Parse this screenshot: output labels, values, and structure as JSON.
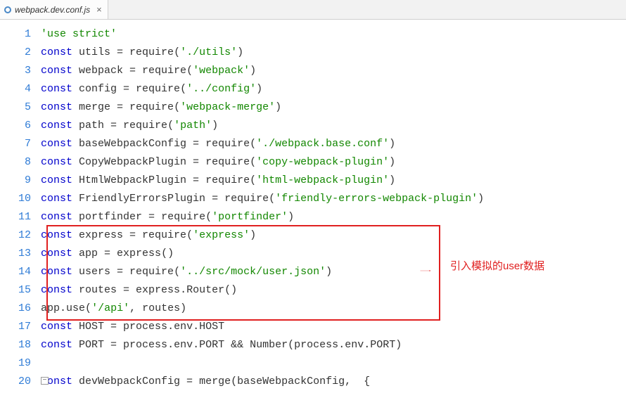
{
  "tab": {
    "filename": "webpack.dev.conf.js",
    "close_glyph": "×"
  },
  "annotation": {
    "text": "引入模拟的user数据"
  },
  "fold_glyph": "−",
  "code": {
    "lines": [
      {
        "n": 1,
        "tokens": [
          [
            "str",
            "'use strict'"
          ]
        ]
      },
      {
        "n": 2,
        "tokens": [
          [
            "kw",
            "const"
          ],
          [
            "id",
            " utils "
          ],
          [
            "op",
            "= "
          ],
          [
            "id",
            "require"
          ],
          [
            "op",
            "("
          ],
          [
            "str",
            "'./utils'"
          ],
          [
            "op",
            ")"
          ]
        ]
      },
      {
        "n": 3,
        "tokens": [
          [
            "kw",
            "const"
          ],
          [
            "id",
            " webpack "
          ],
          [
            "op",
            "= "
          ],
          [
            "id",
            "require"
          ],
          [
            "op",
            "("
          ],
          [
            "str",
            "'webpack'"
          ],
          [
            "op",
            ")"
          ]
        ]
      },
      {
        "n": 4,
        "tokens": [
          [
            "kw",
            "const"
          ],
          [
            "id",
            " config "
          ],
          [
            "op",
            "= "
          ],
          [
            "id",
            "require"
          ],
          [
            "op",
            "("
          ],
          [
            "str",
            "'../config'"
          ],
          [
            "op",
            ")"
          ]
        ]
      },
      {
        "n": 5,
        "tokens": [
          [
            "kw",
            "const"
          ],
          [
            "id",
            " merge "
          ],
          [
            "op",
            "= "
          ],
          [
            "id",
            "require"
          ],
          [
            "op",
            "("
          ],
          [
            "str",
            "'webpack-merge'"
          ],
          [
            "op",
            ")"
          ]
        ]
      },
      {
        "n": 6,
        "tokens": [
          [
            "kw",
            "const"
          ],
          [
            "id",
            " path "
          ],
          [
            "op",
            "= "
          ],
          [
            "id",
            "require"
          ],
          [
            "op",
            "("
          ],
          [
            "str",
            "'path'"
          ],
          [
            "op",
            ")"
          ]
        ]
      },
      {
        "n": 7,
        "tokens": [
          [
            "kw",
            "const"
          ],
          [
            "id",
            " baseWebpackConfig "
          ],
          [
            "op",
            "= "
          ],
          [
            "id",
            "require"
          ],
          [
            "op",
            "("
          ],
          [
            "str",
            "'./webpack.base.conf'"
          ],
          [
            "op",
            ")"
          ]
        ]
      },
      {
        "n": 8,
        "tokens": [
          [
            "kw",
            "const"
          ],
          [
            "id",
            " CopyWebpackPlugin "
          ],
          [
            "op",
            "= "
          ],
          [
            "id",
            "require"
          ],
          [
            "op",
            "("
          ],
          [
            "str",
            "'copy-webpack-plugin'"
          ],
          [
            "op",
            ")"
          ]
        ]
      },
      {
        "n": 9,
        "tokens": [
          [
            "kw",
            "const"
          ],
          [
            "id",
            " HtmlWebpackPlugin "
          ],
          [
            "op",
            "= "
          ],
          [
            "id",
            "require"
          ],
          [
            "op",
            "("
          ],
          [
            "str",
            "'html-webpack-plugin'"
          ],
          [
            "op",
            ")"
          ]
        ]
      },
      {
        "n": 10,
        "tokens": [
          [
            "kw",
            "const"
          ],
          [
            "id",
            " FriendlyErrorsPlugin "
          ],
          [
            "op",
            "= "
          ],
          [
            "id",
            "require"
          ],
          [
            "op",
            "("
          ],
          [
            "str",
            "'friendly-errors-webpack-plugin'"
          ],
          [
            "op",
            ")"
          ]
        ]
      },
      {
        "n": 11,
        "tokens": [
          [
            "kw",
            "const"
          ],
          [
            "id",
            " portfinder "
          ],
          [
            "op",
            "= "
          ],
          [
            "id",
            "require"
          ],
          [
            "op",
            "("
          ],
          [
            "str",
            "'portfinder'"
          ],
          [
            "op",
            ")"
          ]
        ]
      },
      {
        "n": 12,
        "tokens": [
          [
            "kw",
            "const"
          ],
          [
            "id",
            " express "
          ],
          [
            "op",
            "= "
          ],
          [
            "id",
            "require"
          ],
          [
            "op",
            "("
          ],
          [
            "str",
            "'express'"
          ],
          [
            "op",
            ")"
          ]
        ]
      },
      {
        "n": 13,
        "tokens": [
          [
            "kw",
            "const"
          ],
          [
            "id",
            " app "
          ],
          [
            "op",
            "= "
          ],
          [
            "id",
            "express"
          ],
          [
            "op",
            "()"
          ]
        ]
      },
      {
        "n": 14,
        "tokens": [
          [
            "kw",
            "const"
          ],
          [
            "id",
            " users "
          ],
          [
            "op",
            "= "
          ],
          [
            "id",
            "require"
          ],
          [
            "op",
            "("
          ],
          [
            "str",
            "'../src/mock/user.json'"
          ],
          [
            "op",
            ")"
          ]
        ]
      },
      {
        "n": 15,
        "tokens": [
          [
            "kw",
            "const"
          ],
          [
            "id",
            " routes "
          ],
          [
            "op",
            "= "
          ],
          [
            "id",
            "express"
          ],
          [
            "op",
            "."
          ],
          [
            "id",
            "Router"
          ],
          [
            "op",
            "()"
          ]
        ]
      },
      {
        "n": 16,
        "tokens": [
          [
            "id",
            "app"
          ],
          [
            "op",
            "."
          ],
          [
            "id",
            "use"
          ],
          [
            "op",
            "("
          ],
          [
            "str",
            "'/api'"
          ],
          [
            "op",
            ", "
          ],
          [
            "id",
            "routes"
          ],
          [
            "op",
            ")"
          ]
        ]
      },
      {
        "n": 17,
        "tokens": [
          [
            "kw",
            "const"
          ],
          [
            "id",
            " HOST "
          ],
          [
            "op",
            "= "
          ],
          [
            "id",
            "process"
          ],
          [
            "op",
            "."
          ],
          [
            "id",
            "env"
          ],
          [
            "op",
            "."
          ],
          [
            "id",
            "HOST"
          ]
        ]
      },
      {
        "n": 18,
        "tokens": [
          [
            "kw",
            "const"
          ],
          [
            "id",
            " PORT "
          ],
          [
            "op",
            "= "
          ],
          [
            "id",
            "process"
          ],
          [
            "op",
            "."
          ],
          [
            "id",
            "env"
          ],
          [
            "op",
            "."
          ],
          [
            "id",
            "PORT "
          ],
          [
            "op",
            "&& "
          ],
          [
            "id",
            "Number"
          ],
          [
            "op",
            "("
          ],
          [
            "id",
            "process"
          ],
          [
            "op",
            "."
          ],
          [
            "id",
            "env"
          ],
          [
            "op",
            "."
          ],
          [
            "id",
            "PORT"
          ],
          [
            "op",
            ")"
          ]
        ]
      },
      {
        "n": 19,
        "tokens": [
          [
            "id",
            ""
          ]
        ]
      },
      {
        "n": 20,
        "tokens": [
          [
            "kw",
            "const"
          ],
          [
            "id",
            " devWebpackConfig "
          ],
          [
            "op",
            "= "
          ],
          [
            "id",
            "merge"
          ],
          [
            "op",
            "("
          ],
          [
            "id",
            "baseWebpackConfig"
          ],
          [
            "op",
            ",  {"
          ]
        ]
      }
    ]
  }
}
